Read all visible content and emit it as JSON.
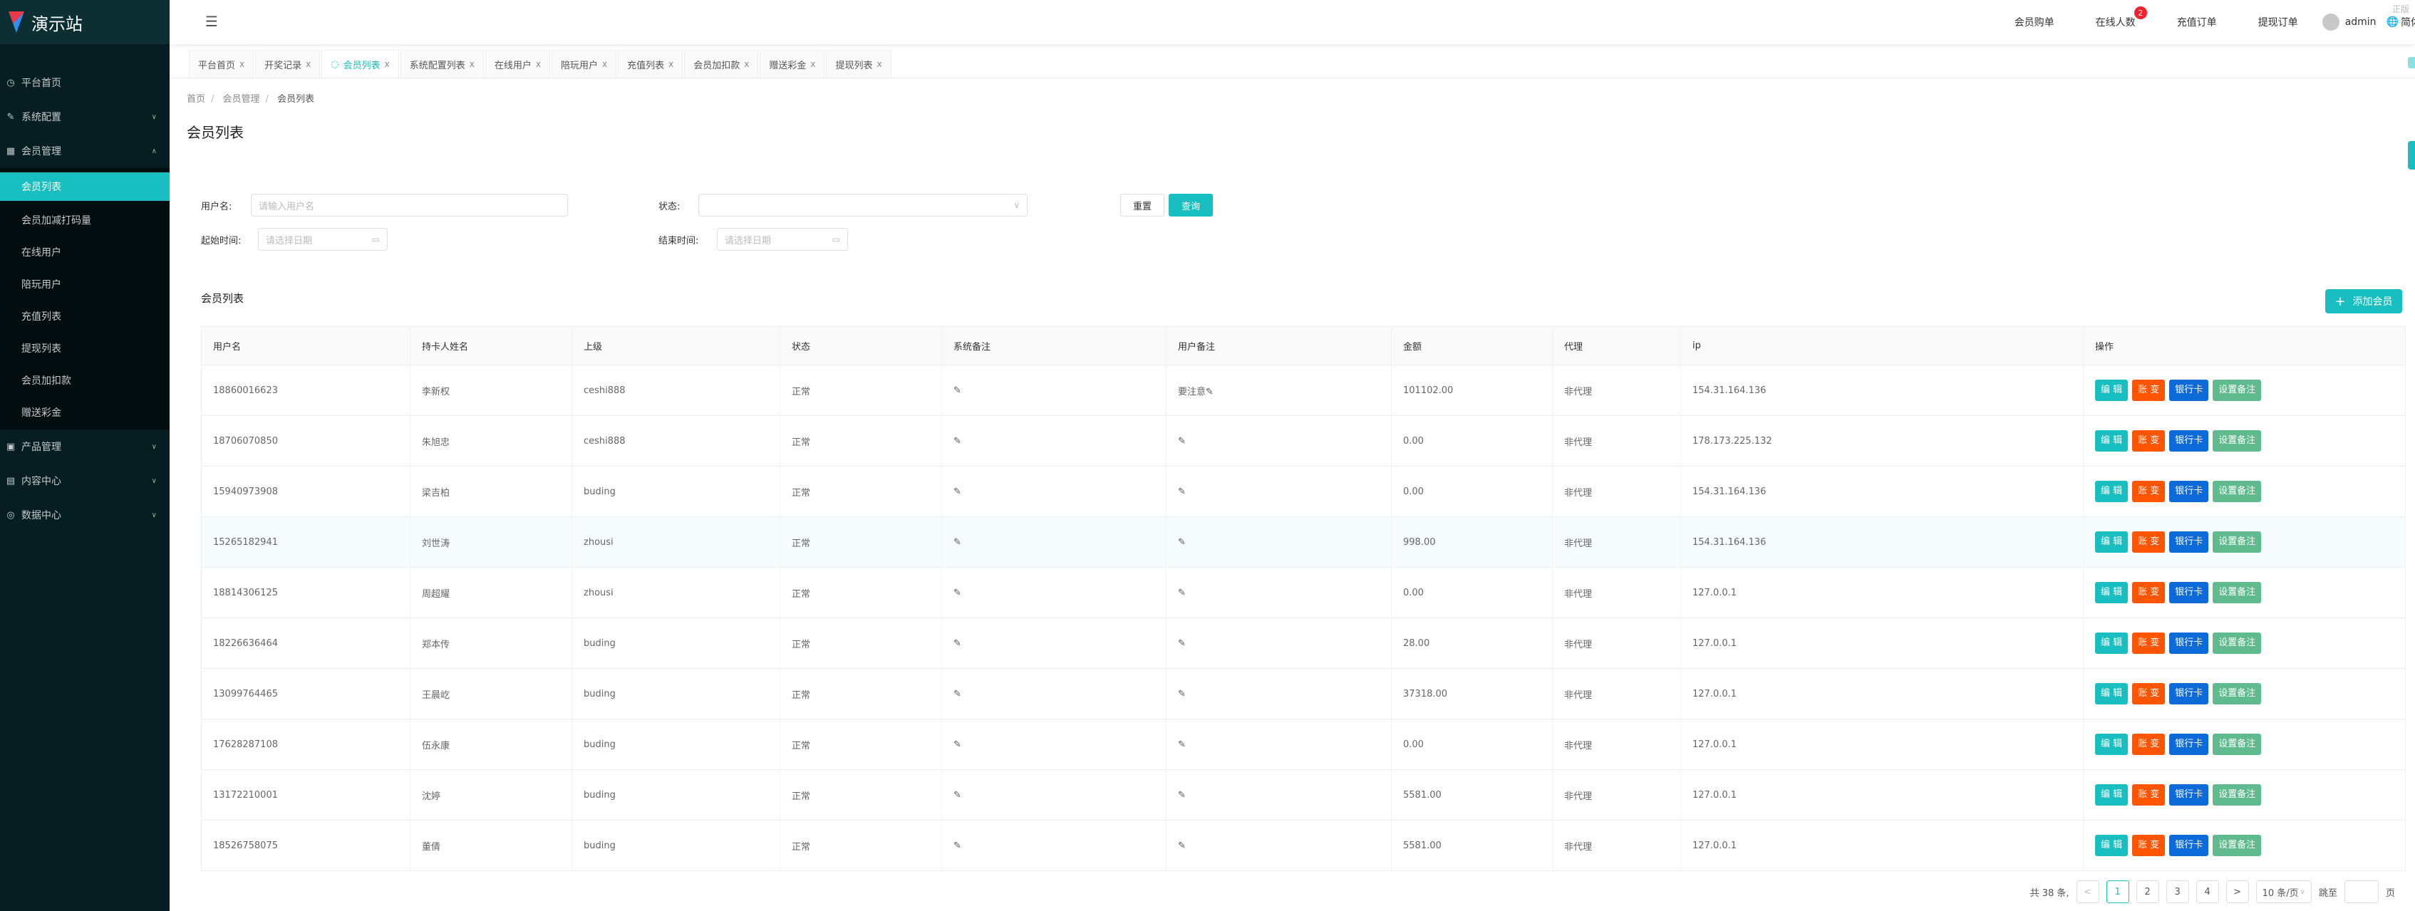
{
  "app": {
    "title": "演示站",
    "watermark": "正版"
  },
  "sidebar": {
    "items": [
      {
        "label": "平台首页",
        "icon": "dashboard-icon"
      },
      {
        "label": "系统配置",
        "icon": "edit-icon"
      },
      {
        "label": "会员管理",
        "icon": "grid-icon",
        "expanded": true
      }
    ],
    "submenu": [
      "会员列表",
      "会员加减打码量",
      "在线用户",
      "陪玩用户",
      "充值列表",
      "提现列表",
      "会员加扣款",
      "赠送彩金"
    ],
    "active_sub": "会员列表",
    "bottom_items": [
      {
        "label": "产品管理",
        "icon": "apps-icon"
      },
      {
        "label": "内容中心",
        "icon": "document-icon"
      },
      {
        "label": "数据中心",
        "icon": "check-circle-icon"
      }
    ]
  },
  "header": {
    "links": [
      "会员购单",
      "在线人数",
      "充值订单",
      "提现订单"
    ],
    "online_badge": "2",
    "user": "admin",
    "language": "简体"
  },
  "tabs": [
    {
      "label": "平台首页"
    },
    {
      "label": "开奖记录"
    },
    {
      "label": "会员列表",
      "active": true
    },
    {
      "label": "系统配置列表"
    },
    {
      "label": "在线用户"
    },
    {
      "label": "陪玩用户"
    },
    {
      "label": "充值列表"
    },
    {
      "label": "会员加扣款"
    },
    {
      "label": "赠送彩金"
    },
    {
      "label": "提现列表"
    }
  ],
  "tab_close": "x",
  "breadcrumb": [
    "首页",
    "会员管理",
    "会员列表"
  ],
  "page_title": "会员列表",
  "filters": {
    "username_label": "用户名:",
    "username_placeholder": "请输入用户名",
    "status_label": "状态:",
    "status_value": "",
    "start_label": "起始时间:",
    "start_placeholder": "请选择日期",
    "end_label": "结束时间:",
    "end_placeholder": "请选择日期",
    "reset": "重置",
    "search": "查询"
  },
  "section_title": "会员列表",
  "add_button": "添加会员",
  "table": {
    "columns": [
      "用户名",
      "持卡人姓名",
      "上级",
      "状态",
      "系统备注",
      "用户备注",
      "金额",
      "代理",
      "ip",
      "操作"
    ],
    "rows": [
      [
        "18860016623",
        "李新权",
        "ceshi888",
        "正常",
        "",
        "要注意",
        "101102.00",
        "非代理",
        "154.31.164.136"
      ],
      [
        "18706070850",
        "朱旭忠",
        "ceshi888",
        "正常",
        "",
        "",
        "0.00",
        "非代理",
        "178.173.225.132"
      ],
      [
        "15940973908",
        "梁吉柏",
        "buding",
        "正常",
        "",
        "",
        "0.00",
        "非代理",
        "154.31.164.136"
      ],
      [
        "15265182941",
        "刘世涛",
        "zhousi",
        "正常",
        "",
        "",
        "998.00",
        "非代理",
        "154.31.164.136"
      ],
      [
        "18814306125",
        "周超耀",
        "zhousi",
        "正常",
        "",
        "",
        "0.00",
        "非代理",
        "127.0.0.1"
      ],
      [
        "18226636464",
        "郑本传",
        "buding",
        "正常",
        "",
        "",
        "28.00",
        "非代理",
        "127.0.0.1"
      ],
      [
        "13099764465",
        "王晨屹",
        "buding",
        "正常",
        "",
        "",
        "37318.00",
        "非代理",
        "127.0.0.1"
      ],
      [
        "17628287108",
        "伍永康",
        "buding",
        "正常",
        "",
        "",
        "0.00",
        "非代理",
        "127.0.0.1"
      ],
      [
        "13172210001",
        "沈婷",
        "buding",
        "正常",
        "",
        "",
        "5581.00",
        "非代理",
        "127.0.0.1"
      ],
      [
        "18526758075",
        "董倩",
        "buding",
        "正常",
        "",
        "",
        "5581.00",
        "非代理",
        "127.0.0.1"
      ]
    ],
    "highlighted_row": 3,
    "actions": [
      {
        "label": "编 辑",
        "color": "#19bfc0"
      },
      {
        "label": "账 变",
        "color": "#ff5500"
      },
      {
        "label": "银行卡",
        "color": "#0c6bd8"
      },
      {
        "label": "设置备注",
        "color": "#5fba8e"
      }
    ]
  },
  "pagination": {
    "total_text": "共 38 条,",
    "pages": [
      "1",
      "2",
      "3",
      "4"
    ],
    "current": "1",
    "page_size": "10 条/页",
    "jump_label": "跳至",
    "page_suffix": "页"
  },
  "colors": {
    "accent": "#19bfc0",
    "sidebar": "#061e21"
  }
}
